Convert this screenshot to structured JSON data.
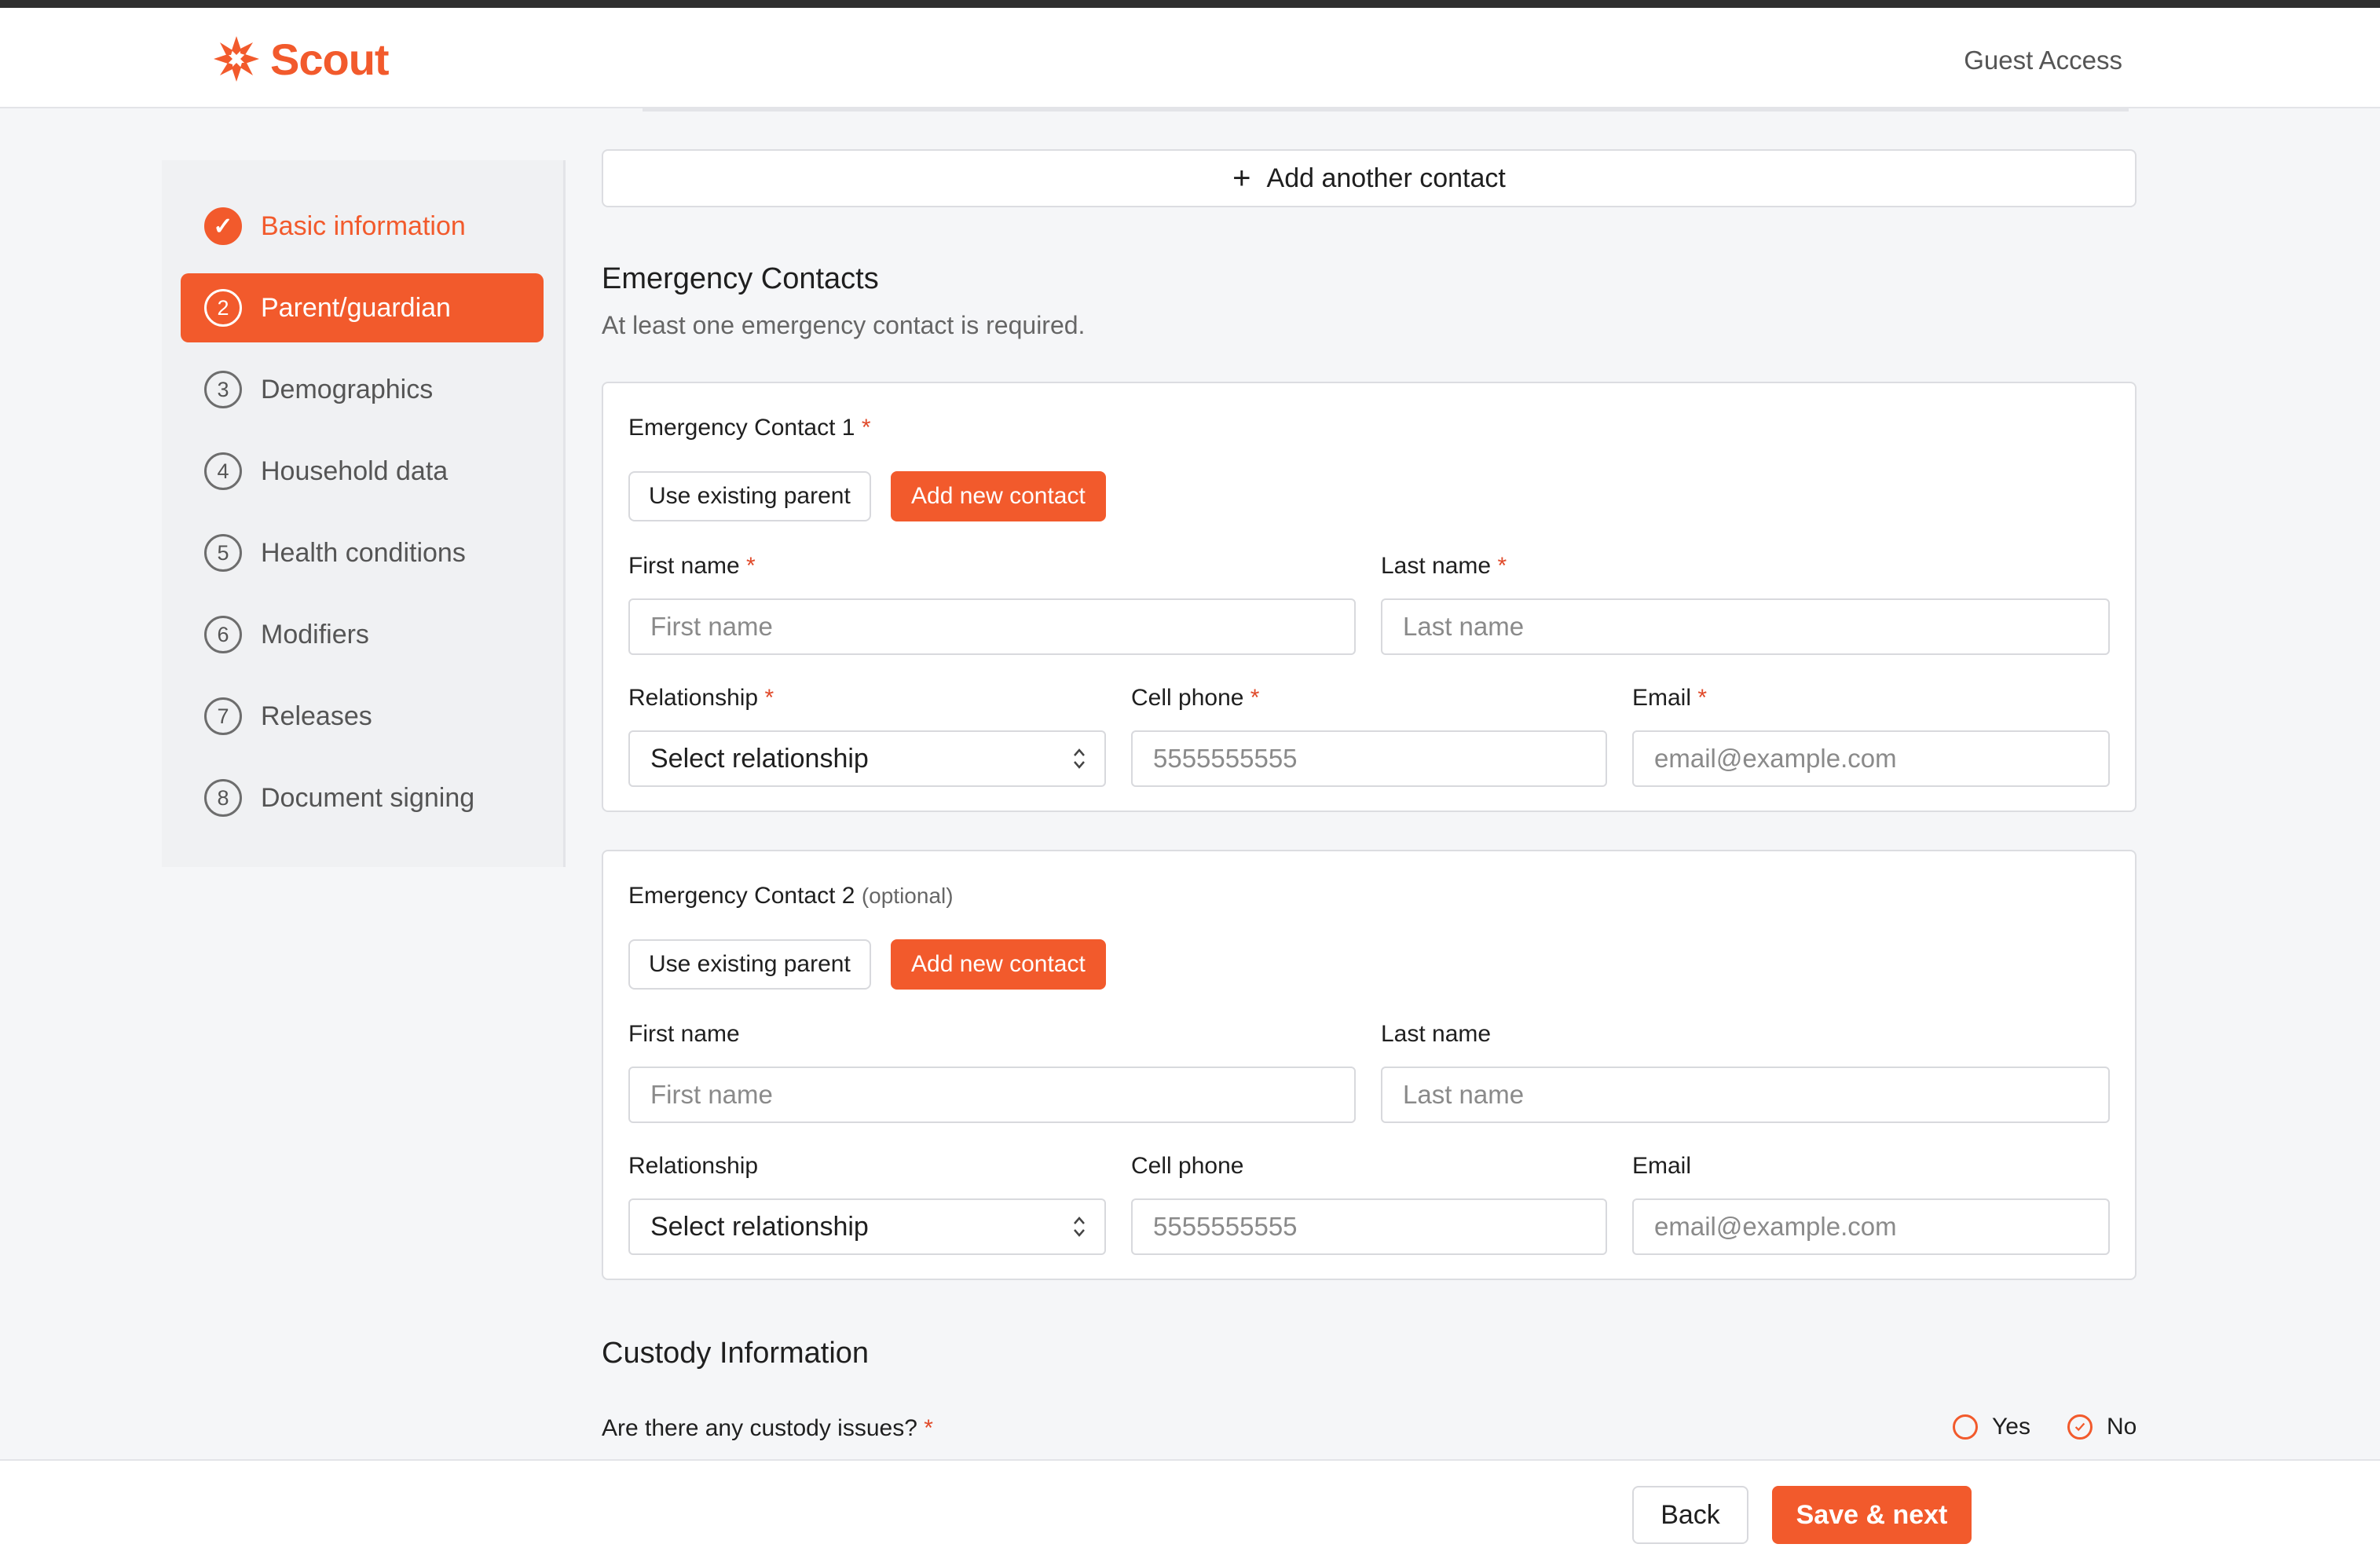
{
  "app": {
    "name": "Scout",
    "guest_label": "Guest Access",
    "accent": "#f25a2c"
  },
  "steps": [
    {
      "num": "✓",
      "label": "Basic information",
      "state": "done"
    },
    {
      "num": "2",
      "label": "Parent/guardian",
      "state": "active"
    },
    {
      "num": "3",
      "label": "Demographics",
      "state": "pending"
    },
    {
      "num": "4",
      "label": "Household data",
      "state": "pending"
    },
    {
      "num": "5",
      "label": "Health conditions",
      "state": "pending"
    },
    {
      "num": "6",
      "label": "Modifiers",
      "state": "pending"
    },
    {
      "num": "7",
      "label": "Releases",
      "state": "pending"
    },
    {
      "num": "8",
      "label": "Document signing",
      "state": "pending"
    }
  ],
  "add_contact": {
    "plus": "+",
    "label": "Add another contact"
  },
  "emergency": {
    "title": "Emergency Contacts",
    "subtitle": "At least one emergency contact is required.",
    "contacts": [
      {
        "title": "Emergency Contact 1",
        "required_mark": "*",
        "optional_label": "",
        "use_existing": "Use existing parent",
        "add_new": "Add new contact",
        "first_name_label": "First name",
        "first_name_req": "*",
        "first_name_placeholder": "First name",
        "last_name_label": "Last name",
        "last_name_req": "*",
        "last_name_placeholder": "Last name",
        "relationship_label": "Relationship",
        "relationship_req": "*",
        "relationship_value": "Select relationship",
        "phone_label": "Cell phone",
        "phone_req": "*",
        "phone_placeholder": "5555555555",
        "email_label": "Email",
        "email_req": "*",
        "email_placeholder": "email@example.com"
      },
      {
        "title": "Emergency Contact 2",
        "required_mark": "",
        "optional_label": "(optional)",
        "use_existing": "Use existing parent",
        "add_new": "Add new contact",
        "first_name_label": "First name",
        "first_name_req": "",
        "first_name_placeholder": "First name",
        "last_name_label": "Last name",
        "last_name_req": "",
        "last_name_placeholder": "Last name",
        "relationship_label": "Relationship",
        "relationship_req": "",
        "relationship_value": "Select relationship",
        "phone_label": "Cell phone",
        "phone_req": "",
        "phone_placeholder": "5555555555",
        "email_label": "Email",
        "email_req": "",
        "email_placeholder": "email@example.com"
      }
    ]
  },
  "custody": {
    "title": "Custody Information",
    "question": "Are there any custody issues?",
    "required_mark": "*",
    "options": [
      {
        "label": "Yes",
        "selected": false
      },
      {
        "label": "No",
        "selected": true
      }
    ]
  },
  "footer": {
    "back": "Back",
    "save": "Save & next"
  }
}
